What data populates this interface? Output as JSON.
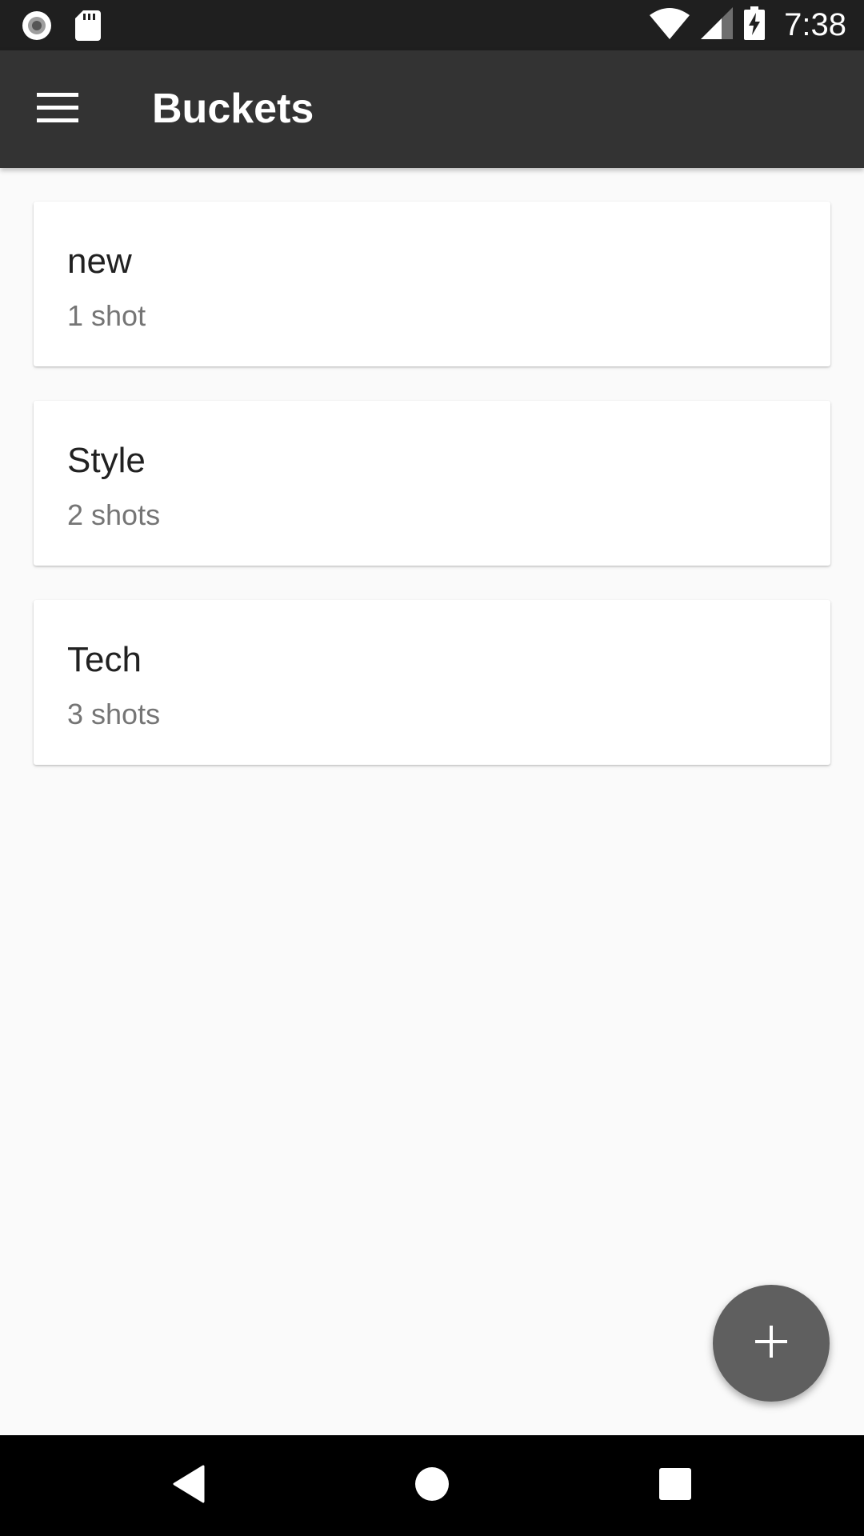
{
  "status_bar": {
    "time": "7:38",
    "left_icons": [
      "record-icon",
      "sd-card-icon"
    ],
    "right_icons": [
      "wifi-icon",
      "cellular-signal-icon",
      "battery-charging-icon"
    ]
  },
  "app_bar": {
    "title": "Buckets",
    "menu_icon": "hamburger-menu-icon"
  },
  "buckets": [
    {
      "name": "new",
      "count": "1 shot"
    },
    {
      "name": "Style",
      "count": "2 shots"
    },
    {
      "name": "Tech",
      "count": "3 shots"
    }
  ],
  "fab": {
    "icon": "plus-icon"
  },
  "nav_bar": {
    "icons": [
      "back-icon",
      "home-icon",
      "recents-icon"
    ]
  },
  "colors": {
    "status_bar": "#1f1f1f",
    "app_bar": "#333333",
    "background": "#fafafa",
    "card": "#ffffff",
    "fab": "#5f5f5f",
    "nav_bar": "#000000"
  }
}
